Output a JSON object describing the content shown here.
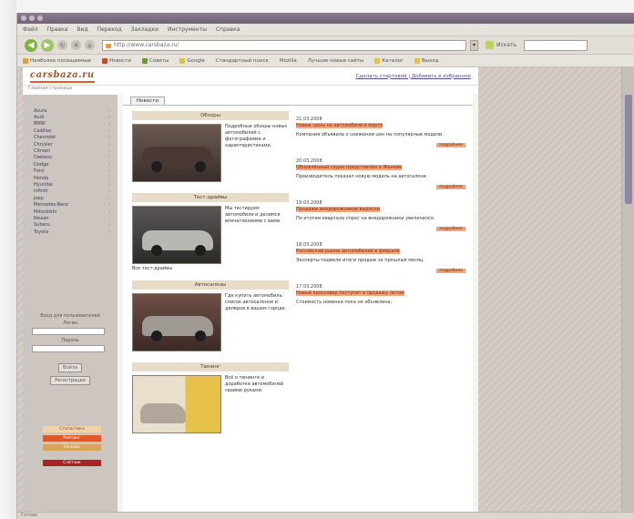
{
  "browser": {
    "title": "",
    "menu": [
      "Файл",
      "Правка",
      "Вид",
      "Переход",
      "Закладки",
      "Инструменты",
      "Справка"
    ],
    "address": "http://www.carsbaza.ru/",
    "search_label": "Искать",
    "bookmarks": [
      "Наиболее посещаемые",
      "Новости",
      "Советы",
      "Google",
      "Стандартный поиск",
      "Mozilla",
      "Лучшие новые сайты",
      "Каталог",
      "Выход"
    ],
    "status": "Готово"
  },
  "site": {
    "logo": "carsbaza.ru",
    "header_links": "Сделать стартовой | Добавить в избранное",
    "breadcrumb": "Главная страница",
    "sidebar": {
      "items": [
        "Acura",
        "Audi",
        "BMW",
        "Cadillac",
        "Chevrolet",
        "Chrysler",
        "Citroen",
        "Daewoo",
        "Dodge",
        "Ford",
        "Honda",
        "Hyundai",
        "Infiniti",
        "Jeep",
        "Mercedes-Benz",
        "Mitsubishi",
        "Nissan",
        "Subaru",
        "Toyota"
      ],
      "login_title": "Вход для пользователей",
      "login_label": "Логин",
      "password_label": "Пароль",
      "enter_button": "Войти",
      "register_button": "Регистрация",
      "badges": [
        "Статистика",
        "Рейтинг",
        "Онлайн",
        "Счётчик"
      ]
    },
    "tabs": [
      "Новости"
    ],
    "categories": [
      {
        "head": "Обзоры",
        "text": "Подробные обзоры новых автомобилей с фотографиями и характеристиками.",
        "foot": ""
      },
      {
        "head": "Тест-драйвы",
        "text": "Мы тестируем автомобили и делимся впечатлениями с вами.",
        "foot": "Все тест-драйвы"
      },
      {
        "head": "Автосалоны",
        "text": "Где купить автомобиль: список автосалонов и дилеров в вашем городе.",
        "foot": ""
      },
      {
        "head": "Тюнинг",
        "text": "Всё о тюнинге и доработке автомобилей своими руками.",
        "foot": ""
      }
    ],
    "news": [
      {
        "date": "21.03.2008",
        "title": "Новые цены на автомобили в марте",
        "body": "Компания объявила о снижении цен на популярные модели.",
        "more": "подробнее"
      },
      {
        "date": "20.03.2008",
        "title": "Обновлённый седан представлен в Женеве",
        "body": "Производитель показал новую модель на автосалоне.",
        "more": "подробнее"
      },
      {
        "date": "19.03.2008",
        "title": "Продажи внедорожников выросли",
        "body": "По итогам квартала спрос на внедорожники увеличился.",
        "more": "подробнее"
      },
      {
        "date": "18.03.2008",
        "title": "Российский рынок автомобилей в феврале",
        "body": "Эксперты подвели итоги продаж за прошлый месяц.",
        "more": "подробнее"
      },
      {
        "date": "17.03.2008",
        "title": "Новый кроссовер поступит в продажу летом",
        "body": "Стоимость новинки пока не объявлена.",
        "more": ""
      }
    ]
  },
  "colors": {
    "accent": "#f5a37a",
    "accent_text": "#7a2c10",
    "sidebar": "#cdc5c0",
    "category_head": "#e6dcc8"
  }
}
